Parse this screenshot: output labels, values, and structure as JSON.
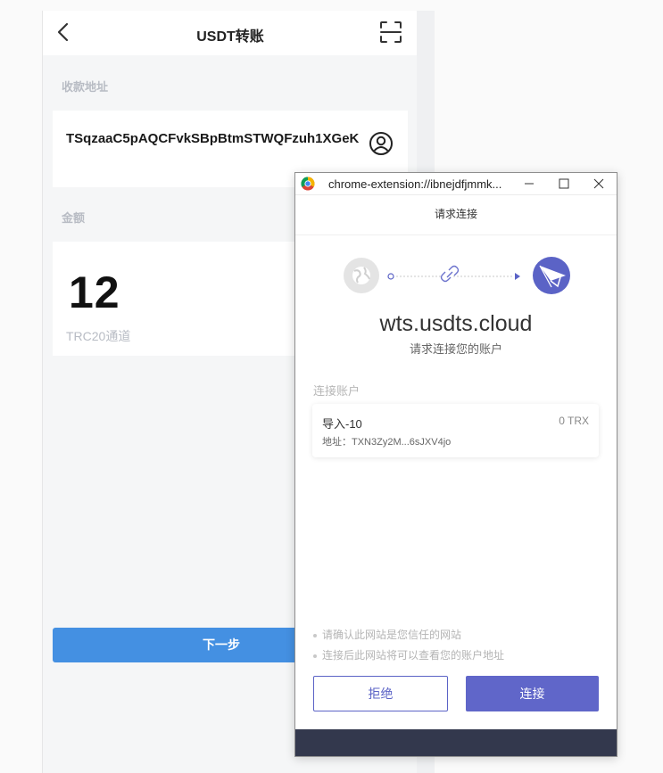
{
  "app": {
    "title": "USDT转账",
    "address_label": "收款地址",
    "address_value": "TSqzaaC5pAQCFvkSBpBtmSTWQFzuh1XGeK",
    "amount_label": "金额",
    "amount_value": "12",
    "channel": "TRC20通道",
    "next_button": "下一步"
  },
  "popup": {
    "window_title": "chrome-extension://ibnejdfjmmk...",
    "header": "请求连接",
    "site": "wts.usdts.cloud",
    "site_sub": "请求连接您的账户",
    "account_section_label": "连接账户",
    "account": {
      "name": "导入-10",
      "balance": "0 TRX",
      "address": "地址：TXN3Zy2M...6sJXV4jo"
    },
    "notes": [
      "请确认此网站是您信任的网站",
      "连接后此网站将可以查看您的账户地址"
    ],
    "reject_button": "拒绝",
    "connect_button": "连接"
  },
  "colors": {
    "primary_blue": "#4490e2",
    "accent_purple": "#6066c9",
    "footer_dark": "#33384d"
  },
  "icons": [
    "back-arrow-icon",
    "scan-icon",
    "contact-icon",
    "chrome-icon",
    "minimize-icon",
    "maximize-icon",
    "close-icon",
    "globe-icon",
    "link-icon",
    "paper-plane-icon"
  ]
}
